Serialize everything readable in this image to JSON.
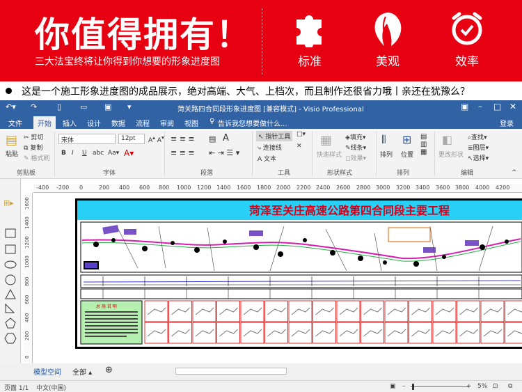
{
  "banner": {
    "headline": "你值得拥有！",
    "subline": "三大法宝终将让你得到你想要的形象进度图",
    "features": [
      {
        "label": "标准",
        "icon": "puzzle-icon"
      },
      {
        "label": "美观",
        "icon": "hair-icon"
      },
      {
        "label": "效率",
        "icon": "clock-icon"
      }
    ],
    "colors": {
      "background": "#e60012",
      "text": "#ffffff"
    }
  },
  "caption": "这是一个施工形象进度图的成品展示，绝对高端、大气、上档次，而且制作还很省力哦丨亲还在犹豫么？",
  "window": {
    "title": "菏关路四合同段形象进度图 [兼容模式] - Visio Professional",
    "accent": "#3062a4"
  },
  "menu": [
    "文件",
    "开始",
    "插入",
    "设计",
    "数据",
    "流程",
    "审阅",
    "视图"
  ],
  "menu_active": "开始",
  "tell_me": "告诉我您想要做什么...",
  "login": "登录",
  "ribbon": {
    "clipboard": {
      "paste": "粘贴",
      "cut": "剪切",
      "copy": "复制",
      "format_painter": "格式刷",
      "group": "剪贴板"
    },
    "font": {
      "family": "宋体",
      "size": "12pt",
      "group": "字体"
    },
    "paragraph": {
      "group": "段落"
    },
    "tools": {
      "pointer": "指针工具",
      "connector": "连接线",
      "text": "A 文本",
      "group": "工具"
    },
    "shape_styles": {
      "quick": "快速样式",
      "fill": "填充",
      "line": "线条",
      "effects": "效果",
      "group": "形状样式"
    },
    "arrange": {
      "align": "排列",
      "position": "位置",
      "group": "排列"
    },
    "editing": {
      "change_shape": "更改形状",
      "find": "查找",
      "layers": "图层",
      "select": "选择",
      "group": "编辑"
    }
  },
  "ruler_h": [
    "-400",
    "-200",
    "0",
    "200",
    "400",
    "600",
    "800",
    "1000",
    "1200",
    "1400",
    "1600",
    "1800",
    "2000",
    "2200",
    "2400",
    "2600",
    "2800",
    "3000",
    "3200",
    "3400",
    "3600",
    "3800",
    "4000",
    "4200"
  ],
  "ruler_v": [
    "1600",
    "1400",
    "1200",
    "1000",
    "800",
    "600",
    "400",
    "200",
    "0"
  ],
  "drawing": {
    "title": "菏泽至关庄高速公路第四合同段主要工程",
    "legend_title": "总 施 说 明"
  },
  "tabs": {
    "page": "模型空间",
    "all": "全部"
  },
  "status": {
    "page": "页面 1/1",
    "language": "中文(中国)",
    "zoom": "5%"
  }
}
